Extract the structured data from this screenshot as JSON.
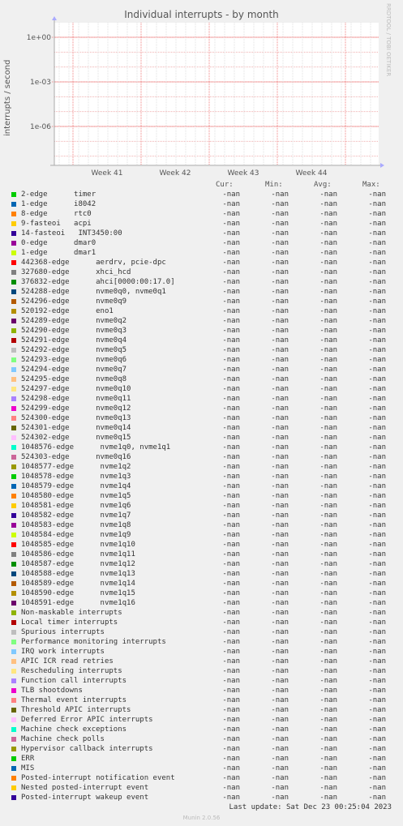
{
  "chart_data": {
    "type": "line",
    "title": "Individual interrupts - by month",
    "ylabel": "interrupts / second",
    "y_scale": "log",
    "y_ticks": [
      "1e+00",
      "1e-03",
      "1e-06"
    ],
    "x_ticks": [
      "Week 41",
      "Week 42",
      "Week 43",
      "Week 44"
    ],
    "grid": true,
    "series_values": "-nan"
  },
  "side_text": "RRDTOOL / TOBI OETIKER",
  "legend_headers": {
    "cur": "Cur:",
    "min": "Min:",
    "avg": "Avg:",
    "max": "Max:"
  },
  "legend": [
    {
      "name": "2-edge      timer",
      "color": "#00cc00",
      "cur": "-nan",
      "min": "-nan",
      "avg": "-nan",
      "max": "-nan"
    },
    {
      "name": "1-edge      i8042",
      "color": "#0066b3",
      "cur": "-nan",
      "min": "-nan",
      "avg": "-nan",
      "max": "-nan"
    },
    {
      "name": "8-edge      rtc0",
      "color": "#ff8000",
      "cur": "-nan",
      "min": "-nan",
      "avg": "-nan",
      "max": "-nan"
    },
    {
      "name": "9-fasteoi   acpi",
      "color": "#ffcc00",
      "cur": "-nan",
      "min": "-nan",
      "avg": "-nan",
      "max": "-nan"
    },
    {
      "name": "14-fasteoi   INT3450:00",
      "color": "#330099",
      "cur": "-nan",
      "min": "-nan",
      "avg": "-nan",
      "max": "-nan"
    },
    {
      "name": "0-edge      dmar0",
      "color": "#990099",
      "cur": "-nan",
      "min": "-nan",
      "avg": "-nan",
      "max": "-nan"
    },
    {
      "name": "1-edge      dmar1",
      "color": "#ccff00",
      "cur": "-nan",
      "min": "-nan",
      "avg": "-nan",
      "max": "-nan"
    },
    {
      "name": "442368-edge      aerdrv, pcie-dpc",
      "color": "#ff0000",
      "cur": "-nan",
      "min": "-nan",
      "avg": "-nan",
      "max": "-nan"
    },
    {
      "name": "327680-edge      xhci_hcd",
      "color": "#808080",
      "cur": "-nan",
      "min": "-nan",
      "avg": "-nan",
      "max": "-nan"
    },
    {
      "name": "376832-edge      ahci[0000:00:17.0]",
      "color": "#008f00",
      "cur": "-nan",
      "min": "-nan",
      "avg": "-nan",
      "max": "-nan"
    },
    {
      "name": "524288-edge      nvme0q0, nvme0q1",
      "color": "#00487d",
      "cur": "-nan",
      "min": "-nan",
      "avg": "-nan",
      "max": "-nan"
    },
    {
      "name": "524296-edge      nvme0q9",
      "color": "#b35a00",
      "cur": "-nan",
      "min": "-nan",
      "avg": "-nan",
      "max": "-nan"
    },
    {
      "name": "520192-edge      eno1",
      "color": "#b38f00",
      "cur": "-nan",
      "min": "-nan",
      "avg": "-nan",
      "max": "-nan"
    },
    {
      "name": "524289-edge      nvme0q2",
      "color": "#6b006b",
      "cur": "-nan",
      "min": "-nan",
      "avg": "-nan",
      "max": "-nan"
    },
    {
      "name": "524290-edge      nvme0q3",
      "color": "#8fb300",
      "cur": "-nan",
      "min": "-nan",
      "avg": "-nan",
      "max": "-nan"
    },
    {
      "name": "524291-edge      nvme0q4",
      "color": "#b30000",
      "cur": "-nan",
      "min": "-nan",
      "avg": "-nan",
      "max": "-nan"
    },
    {
      "name": "524292-edge      nvme0q5",
      "color": "#bebebe",
      "cur": "-nan",
      "min": "-nan",
      "avg": "-nan",
      "max": "-nan"
    },
    {
      "name": "524293-edge      nvme0q6",
      "color": "#80ff80",
      "cur": "-nan",
      "min": "-nan",
      "avg": "-nan",
      "max": "-nan"
    },
    {
      "name": "524294-edge      nvme0q7",
      "color": "#80c9ff",
      "cur": "-nan",
      "min": "-nan",
      "avg": "-nan",
      "max": "-nan"
    },
    {
      "name": "524295-edge      nvme0q8",
      "color": "#ffc080",
      "cur": "-nan",
      "min": "-nan",
      "avg": "-nan",
      "max": "-nan"
    },
    {
      "name": "524297-edge      nvme0q10",
      "color": "#ffe680",
      "cur": "-nan",
      "min": "-nan",
      "avg": "-nan",
      "max": "-nan"
    },
    {
      "name": "524298-edge      nvme0q11",
      "color": "#aa80ff",
      "cur": "-nan",
      "min": "-nan",
      "avg": "-nan",
      "max": "-nan"
    },
    {
      "name": "524299-edge      nvme0q12",
      "color": "#ee00cc",
      "cur": "-nan",
      "min": "-nan",
      "avg": "-nan",
      "max": "-nan"
    },
    {
      "name": "524300-edge      nvme0q13",
      "color": "#ff8080",
      "cur": "-nan",
      "min": "-nan",
      "avg": "-nan",
      "max": "-nan"
    },
    {
      "name": "524301-edge      nvme0q14",
      "color": "#666600",
      "cur": "-nan",
      "min": "-nan",
      "avg": "-nan",
      "max": "-nan"
    },
    {
      "name": "524302-edge      nvme0q15",
      "color": "#ffbfff",
      "cur": "-nan",
      "min": "-nan",
      "avg": "-nan",
      "max": "-nan"
    },
    {
      "name": "1048576-edge      nvme1q0, nvme1q1",
      "color": "#00ffcc",
      "cur": "-nan",
      "min": "-nan",
      "avg": "-nan",
      "max": "-nan"
    },
    {
      "name": "524303-edge      nvme0q16",
      "color": "#cc6699",
      "cur": "-nan",
      "min": "-nan",
      "avg": "-nan",
      "max": "-nan"
    },
    {
      "name": "1048577-edge      nvme1q2",
      "color": "#999900",
      "cur": "-nan",
      "min": "-nan",
      "avg": "-nan",
      "max": "-nan"
    },
    {
      "name": "1048578-edge      nvme1q3",
      "color": "#00cc00",
      "cur": "-nan",
      "min": "-nan",
      "avg": "-nan",
      "max": "-nan"
    },
    {
      "name": "1048579-edge      nvme1q4",
      "color": "#0066b3",
      "cur": "-nan",
      "min": "-nan",
      "avg": "-nan",
      "max": "-nan"
    },
    {
      "name": "1048580-edge      nvme1q5",
      "color": "#ff8000",
      "cur": "-nan",
      "min": "-nan",
      "avg": "-nan",
      "max": "-nan"
    },
    {
      "name": "1048581-edge      nvme1q6",
      "color": "#ffcc00",
      "cur": "-nan",
      "min": "-nan",
      "avg": "-nan",
      "max": "-nan"
    },
    {
      "name": "1048582-edge      nvme1q7",
      "color": "#330099",
      "cur": "-nan",
      "min": "-nan",
      "avg": "-nan",
      "max": "-nan"
    },
    {
      "name": "1048583-edge      nvme1q8",
      "color": "#990099",
      "cur": "-nan",
      "min": "-nan",
      "avg": "-nan",
      "max": "-nan"
    },
    {
      "name": "1048584-edge      nvme1q9",
      "color": "#ccff00",
      "cur": "-nan",
      "min": "-nan",
      "avg": "-nan",
      "max": "-nan"
    },
    {
      "name": "1048585-edge      nvme1q10",
      "color": "#ff0000",
      "cur": "-nan",
      "min": "-nan",
      "avg": "-nan",
      "max": "-nan"
    },
    {
      "name": "1048586-edge      nvme1q11",
      "color": "#808080",
      "cur": "-nan",
      "min": "-nan",
      "avg": "-nan",
      "max": "-nan"
    },
    {
      "name": "1048587-edge      nvme1q12",
      "color": "#008f00",
      "cur": "-nan",
      "min": "-nan",
      "avg": "-nan",
      "max": "-nan"
    },
    {
      "name": "1048588-edge      nvme1q13",
      "color": "#00487d",
      "cur": "-nan",
      "min": "-nan",
      "avg": "-nan",
      "max": "-nan"
    },
    {
      "name": "1048589-edge      nvme1q14",
      "color": "#b35a00",
      "cur": "-nan",
      "min": "-nan",
      "avg": "-nan",
      "max": "-nan"
    },
    {
      "name": "1048590-edge      nvme1q15",
      "color": "#b38f00",
      "cur": "-nan",
      "min": "-nan",
      "avg": "-nan",
      "max": "-nan"
    },
    {
      "name": "1048591-edge      nvme1q16",
      "color": "#6b006b",
      "cur": "-nan",
      "min": "-nan",
      "avg": "-nan",
      "max": "-nan"
    },
    {
      "name": "Non-maskable interrupts",
      "color": "#8fb300",
      "cur": "-nan",
      "min": "-nan",
      "avg": "-nan",
      "max": "-nan"
    },
    {
      "name": "Local timer interrupts",
      "color": "#b30000",
      "cur": "-nan",
      "min": "-nan",
      "avg": "-nan",
      "max": "-nan"
    },
    {
      "name": "Spurious interrupts",
      "color": "#bebebe",
      "cur": "-nan",
      "min": "-nan",
      "avg": "-nan",
      "max": "-nan"
    },
    {
      "name": "Performance monitoring interrupts",
      "color": "#80ff80",
      "cur": "-nan",
      "min": "-nan",
      "avg": "-nan",
      "max": "-nan"
    },
    {
      "name": "IRQ work interrupts",
      "color": "#80c9ff",
      "cur": "-nan",
      "min": "-nan",
      "avg": "-nan",
      "max": "-nan"
    },
    {
      "name": "APIC ICR read retries",
      "color": "#ffc080",
      "cur": "-nan",
      "min": "-nan",
      "avg": "-nan",
      "max": "-nan"
    },
    {
      "name": "Rescheduling interrupts",
      "color": "#ffe680",
      "cur": "-nan",
      "min": "-nan",
      "avg": "-nan",
      "max": "-nan"
    },
    {
      "name": "Function call interrupts",
      "color": "#aa80ff",
      "cur": "-nan",
      "min": "-nan",
      "avg": "-nan",
      "max": "-nan"
    },
    {
      "name": "TLB shootdowns",
      "color": "#ee00cc",
      "cur": "-nan",
      "min": "-nan",
      "avg": "-nan",
      "max": "-nan"
    },
    {
      "name": "Thermal event interrupts",
      "color": "#ff8080",
      "cur": "-nan",
      "min": "-nan",
      "avg": "-nan",
      "max": "-nan"
    },
    {
      "name": "Threshold APIC interrupts",
      "color": "#666600",
      "cur": "-nan",
      "min": "-nan",
      "avg": "-nan",
      "max": "-nan"
    },
    {
      "name": "Deferred Error APIC interrupts",
      "color": "#ffbfff",
      "cur": "-nan",
      "min": "-nan",
      "avg": "-nan",
      "max": "-nan"
    },
    {
      "name": "Machine check exceptions",
      "color": "#00ffcc",
      "cur": "-nan",
      "min": "-nan",
      "avg": "-nan",
      "max": "-nan"
    },
    {
      "name": "Machine check polls",
      "color": "#cc6699",
      "cur": "-nan",
      "min": "-nan",
      "avg": "-nan",
      "max": "-nan"
    },
    {
      "name": "Hypervisor callback interrupts",
      "color": "#999900",
      "cur": "-nan",
      "min": "-nan",
      "avg": "-nan",
      "max": "-nan"
    },
    {
      "name": "ERR",
      "color": "#00cc00",
      "cur": "-nan",
      "min": "-nan",
      "avg": "-nan",
      "max": "-nan"
    },
    {
      "name": "MIS",
      "color": "#0066b3",
      "cur": "-nan",
      "min": "-nan",
      "avg": "-nan",
      "max": "-nan"
    },
    {
      "name": "Posted-interrupt notification event",
      "color": "#ff8000",
      "cur": "-nan",
      "min": "-nan",
      "avg": "-nan",
      "max": "-nan"
    },
    {
      "name": "Nested posted-interrupt event",
      "color": "#ffcc00",
      "cur": "-nan",
      "min": "-nan",
      "avg": "-nan",
      "max": "-nan"
    },
    {
      "name": "Posted-interrupt wakeup event",
      "color": "#330099",
      "cur": "-nan",
      "min": "-nan",
      "avg": "-nan",
      "max": "-nan"
    }
  ],
  "last_update": "Last update: Sat Dec 23 00:25:04 2023",
  "footer": "Munin 2.0.56"
}
